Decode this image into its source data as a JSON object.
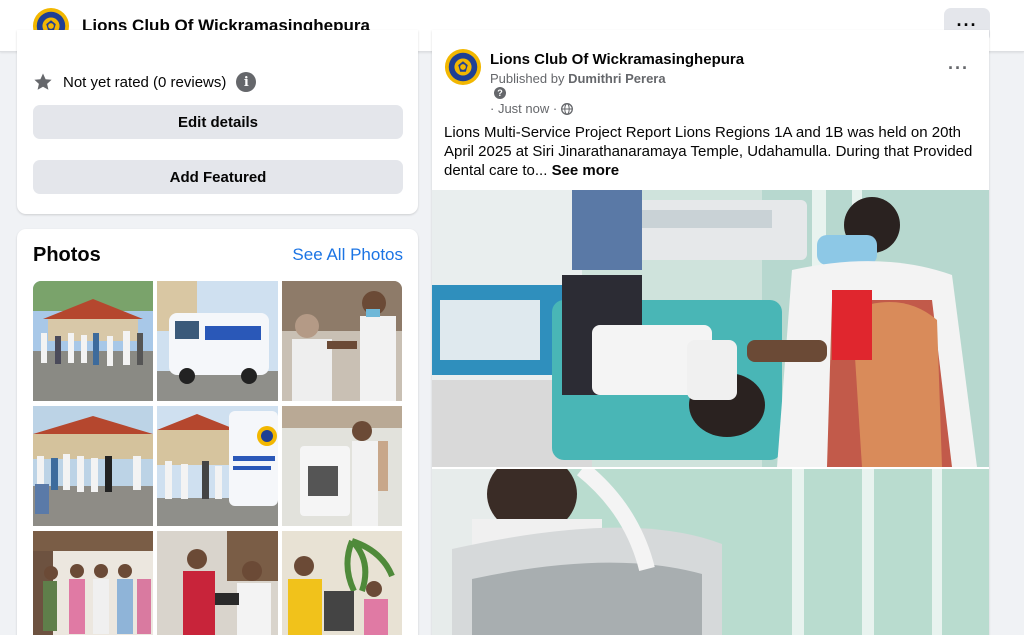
{
  "header": {
    "page_name": "Lions Club Of Wickramasinghepura",
    "more_icon": "more-horizontal-icon"
  },
  "about": {
    "rating_text": "Not yet rated (0 reviews)",
    "edit_details_label": "Edit details",
    "add_featured_label": "Add Featured"
  },
  "photos": {
    "title": "Photos",
    "see_all_label": "See All Photos"
  },
  "post": {
    "author": "Lions Club Of Wickramasinghepura",
    "published_prefix": "Published by ",
    "publisher": "Dumithri Perera",
    "time": "· Just now ·",
    "text": "Lions Multi-Service Project Report Lions Regions 1A and 1B was held on 20th April 2025 at Siri Jinarathanaramaya Temple, Udahamulla. During that Provided dental care to...",
    "see_more_label": "See more"
  },
  "colors": {
    "link_blue": "#1b74e4",
    "button_gray": "#e4e6eb",
    "secondary_text": "#65676b",
    "lions_gold": "#f2b701",
    "lions_blue": "#1f3f94"
  }
}
